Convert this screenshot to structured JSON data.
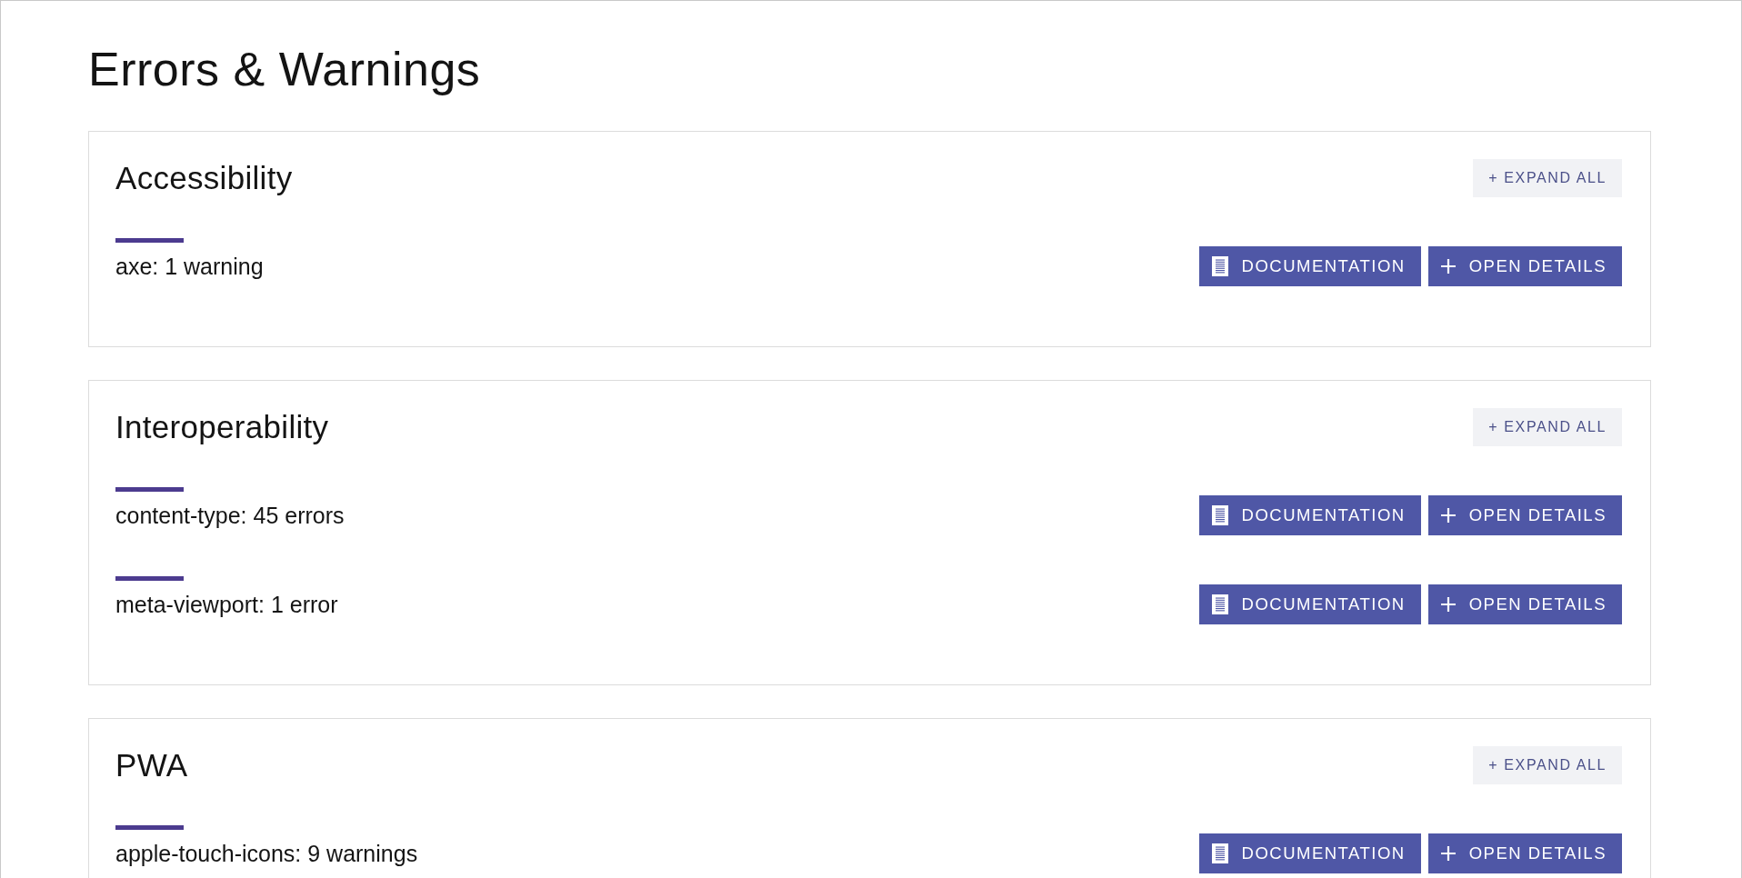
{
  "page": {
    "title": "Errors & Warnings"
  },
  "sections": [
    {
      "title": "Accessibility",
      "expand_button": "+ EXPAND ALL",
      "items": [
        {
          "label": "axe: 1 warning",
          "documentation_button": "DOCUMENTATION",
          "details_button": "OPEN DETAILS"
        }
      ]
    },
    {
      "title": "Interoperability",
      "expand_button": "+ EXPAND ALL",
      "items": [
        {
          "label": "content-type: 45 errors",
          "documentation_button": "DOCUMENTATION",
          "details_button": "OPEN DETAILS"
        },
        {
          "label": "meta-viewport: 1 error",
          "documentation_button": "DOCUMENTATION",
          "details_button": "OPEN DETAILS"
        }
      ]
    },
    {
      "title": "PWA",
      "expand_button": "+ EXPAND ALL",
      "items": [
        {
          "label": "apple-touch-icons: 9 warnings",
          "documentation_button": "DOCUMENTATION",
          "details_button": "OPEN DETAILS"
        }
      ]
    }
  ]
}
